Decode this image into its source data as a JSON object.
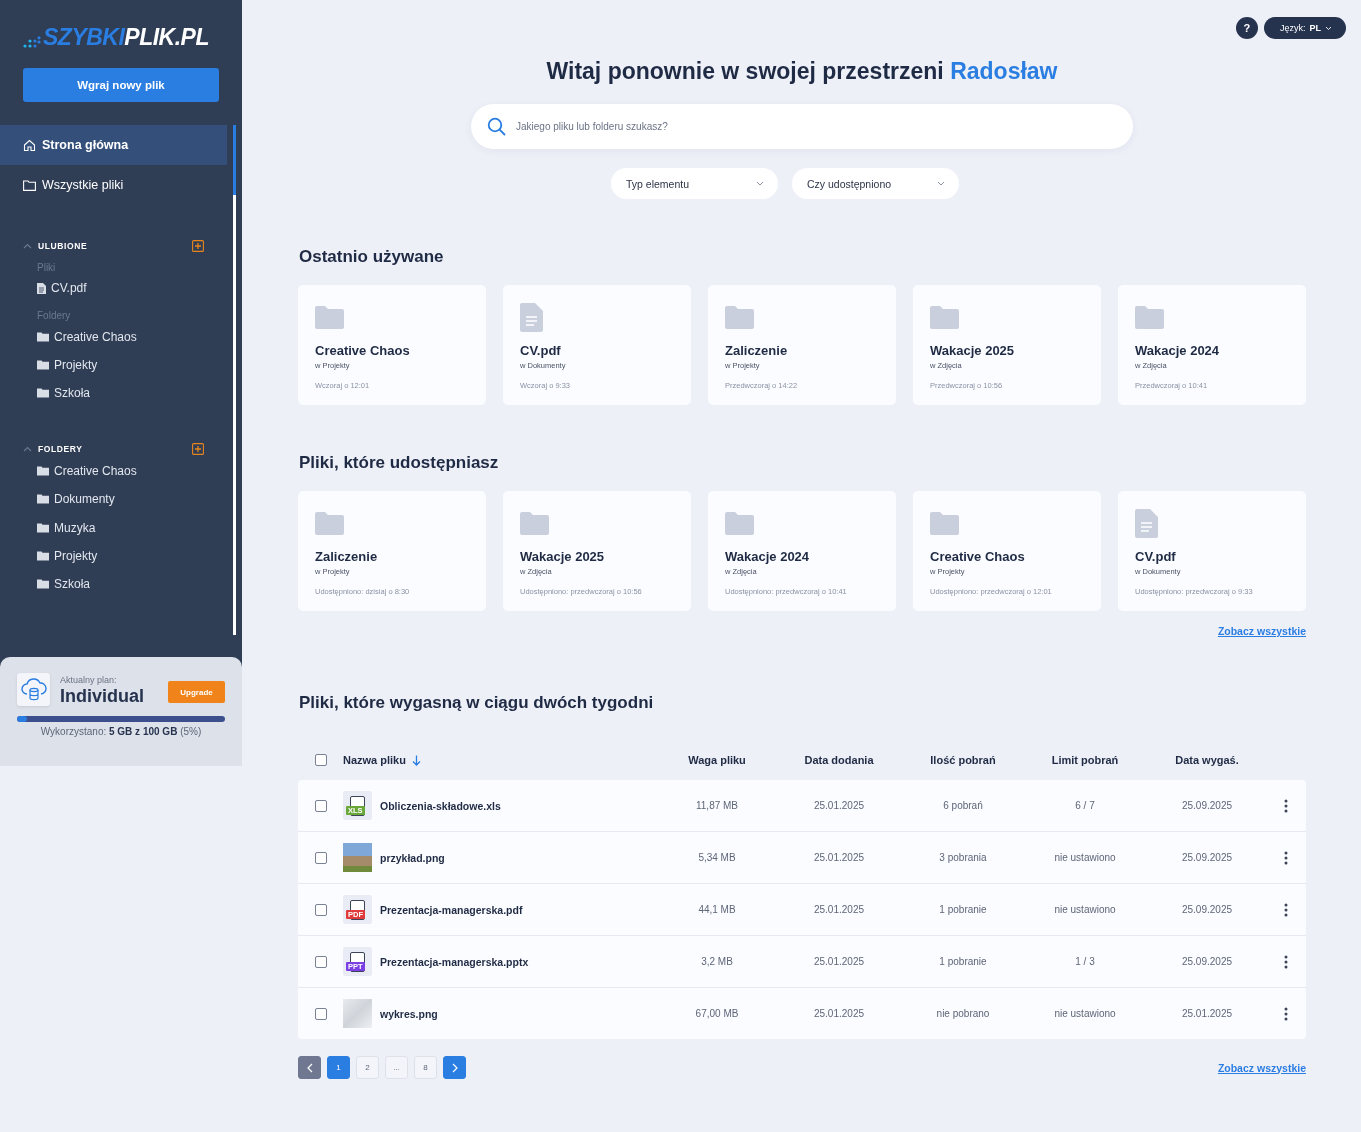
{
  "sidebar": {
    "logo": {
      "part1": "SZYBKI",
      "part2": "PLIK.PL"
    },
    "upload_button": "Wgraj nowy plik",
    "nav": [
      {
        "label": "Strona główna",
        "kind": "home",
        "selected": true
      },
      {
        "label": "Wszystkie pliki",
        "kind": "folder",
        "selected": false
      }
    ],
    "sections": [
      {
        "title": "ULUBIONE",
        "expanded": true,
        "groups": [
          {
            "label": "Pliki",
            "items": [
              {
                "label": "CV.pdf",
                "kind": "file"
              }
            ]
          },
          {
            "label": "Foldery",
            "items": [
              {
                "label": "Creative Chaos",
                "kind": "folder"
              },
              {
                "label": "Projekty",
                "kind": "folder"
              },
              {
                "label": "Szkoła",
                "kind": "folder"
              }
            ]
          }
        ]
      },
      {
        "title": "FOLDERY",
        "expanded": true,
        "groups": [
          {
            "items": [
              {
                "label": "Creative Chaos",
                "kind": "folder"
              },
              {
                "label": "Dokumenty",
                "kind": "folder"
              },
              {
                "label": "Muzyka",
                "kind": "folder"
              },
              {
                "label": "Projekty",
                "kind": "folder"
              },
              {
                "label": "Szkoła",
                "kind": "folder"
              }
            ]
          }
        ]
      }
    ],
    "plan": {
      "label": "Aktualny plan:",
      "name": "Individual",
      "upgrade_button": "Upgrade",
      "level": 0.05,
      "usage": "Wykorzystano: **5 GB z 100 GB** (5%)"
    }
  },
  "topbar": {
    "help": "?",
    "language": "Język: **PL**"
  },
  "greeting": {
    "text": "Witaj ponownie w swojej przestrzeni",
    "user_name": "Radosław"
  },
  "search": {
    "placeholder": "Jakiego pliku lub folderu szukasz?"
  },
  "filters": [
    "Typ elementu",
    "Czy udostępniono"
  ],
  "recent": {
    "title": "Ostatnio używane",
    "cards": [
      {
        "kind": "folder",
        "name": "Creative Chaos",
        "location": "w Projekty",
        "time": "Wczoraj o 12:01"
      },
      {
        "kind": "file",
        "name": "CV.pdf",
        "location": "w Dokumenty",
        "time": "Wczoraj o 9:33"
      },
      {
        "kind": "folder",
        "name": "Zaliczenie",
        "location": "w Projekty",
        "time": "Przedwczoraj o 14:22"
      },
      {
        "kind": "folder",
        "name": "Wakacje 2025",
        "location": "w Zdjęcia",
        "time": "Przedwczoraj o 10:56"
      },
      {
        "kind": "folder",
        "name": "Wakacje 2024",
        "location": "w Zdjęcia",
        "time": "Przedwczoraj o 10:41"
      }
    ]
  },
  "shared": {
    "title": "Pliki, które udostępniasz",
    "see_all": "Zobacz wszystkie",
    "cards": [
      {
        "kind": "folder",
        "name": "Zaliczenie",
        "location": "w Projekty",
        "time": "Udostępniono: dzisiaj o 8:30"
      },
      {
        "kind": "folder",
        "name": "Wakacje 2025",
        "location": "w Zdjęcia",
        "time": "Udostępniono: przedwczoraj o 10:56"
      },
      {
        "kind": "folder",
        "name": "Wakacje 2024",
        "location": "w Zdjęcia",
        "time": "Udostępniono: przedwczoraj o 10:41"
      },
      {
        "kind": "folder",
        "name": "Creative Chaos",
        "location": "w Projekty",
        "time": "Udostępniono: przedwczoraj o 12:01"
      },
      {
        "kind": "file",
        "name": "CV.pdf",
        "location": "w Dokumenty",
        "time": "Udostępniono: przedwczoraj o 9:33"
      }
    ]
  },
  "expiring": {
    "title": "Pliki, które wygasną w ciągu dwóch tygodni",
    "select_all_checked": false,
    "columns": [
      {
        "label": "Nazwa pliku",
        "sorted": true
      },
      {
        "label": "Waga pliku",
        "sorted": false
      },
      {
        "label": "Data dodania",
        "sorted": false
      },
      {
        "label": "Ilość pobrań",
        "sorted": false
      },
      {
        "label": "Limit pobrań",
        "sorted": false
      },
      {
        "label": "Data wygaś.",
        "sorted": false
      }
    ],
    "rows": [
      {
        "kind": "xls",
        "badge": "XLS",
        "name": "Obliczenia-składowe.xls",
        "size": "11,87 MB",
        "added": "25.01.2025",
        "downloads": "6 pobrań",
        "limit": "6 / 7",
        "expires": "25.09.2025",
        "checked": false
      },
      {
        "kind": "photo",
        "name": "przykład.png",
        "size": "5,34 MB",
        "added": "25.01.2025",
        "downloads": "3 pobrania",
        "limit": "nie ustawiono",
        "expires": "25.09.2025",
        "checked": false
      },
      {
        "kind": "pdf",
        "badge": "PDF",
        "name": "Prezentacja-managerska.pdf",
        "size": "44,1 MB",
        "added": "25.01.2025",
        "downloads": "1 pobranie",
        "limit": "nie ustawiono",
        "expires": "25.09.2025",
        "checked": false
      },
      {
        "kind": "pptx",
        "badge": "PPT",
        "name": "Prezentacja-managerska.pptx",
        "size": "3,2 MB",
        "added": "25.01.2025",
        "downloads": "1 pobranie",
        "limit": "1 / 3",
        "expires": "25.09.2025",
        "checked": false
      },
      {
        "kind": "chart-image",
        "name": "wykres.png",
        "size": "67,00 MB",
        "added": "25.01.2025",
        "downloads": "nie pobrano",
        "limit": "nie ustawiono",
        "expires": "25.01.2025",
        "checked": false
      }
    ],
    "pagination": {
      "prev_disabled": true,
      "pages": [
        {
          "label": "1",
          "selected": true
        },
        {
          "label": "2",
          "selected": false
        },
        {
          "label": "...",
          "selected": false
        },
        {
          "label": "8",
          "selected": false
        }
      ]
    },
    "see_all": "Zobacz wszystkie"
  }
}
